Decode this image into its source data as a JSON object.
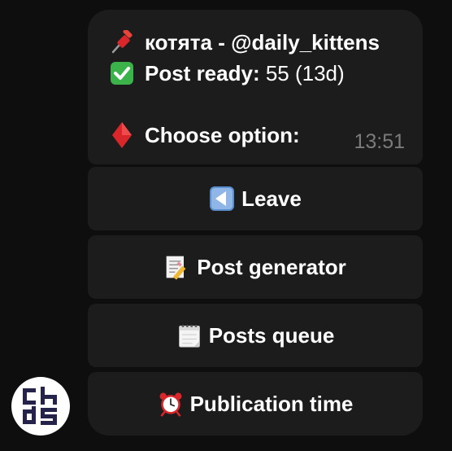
{
  "message": {
    "channel_line": "котята - @daily_kittens",
    "post_ready_label": "Post ready:",
    "post_ready_value": " 55 (13d)",
    "choose_label": "Choose option:",
    "time": "13:51",
    "icons": [
      "pushpin-icon",
      "check-mark-icon",
      "red-diamond-icon"
    ]
  },
  "keyboard": {
    "buttons": [
      {
        "label": "Leave",
        "icon": "back-arrow-icon"
      },
      {
        "label": "Post generator",
        "icon": "memo-pencil-icon"
      },
      {
        "label": "Posts queue",
        "icon": "calendar-icon"
      },
      {
        "label": "Publication time",
        "icon": "alarm-clock-icon"
      }
    ]
  },
  "colors": {
    "background": "#0e0e0e",
    "bubble": "#1c1c1d",
    "text": "#ffffff",
    "timestamp": "#7b7b7e",
    "check_green": "#3cb34a",
    "diamond_red": "#d9262a",
    "leave_blue": "#5a8fd0",
    "avatar_logo": "#26234a"
  }
}
